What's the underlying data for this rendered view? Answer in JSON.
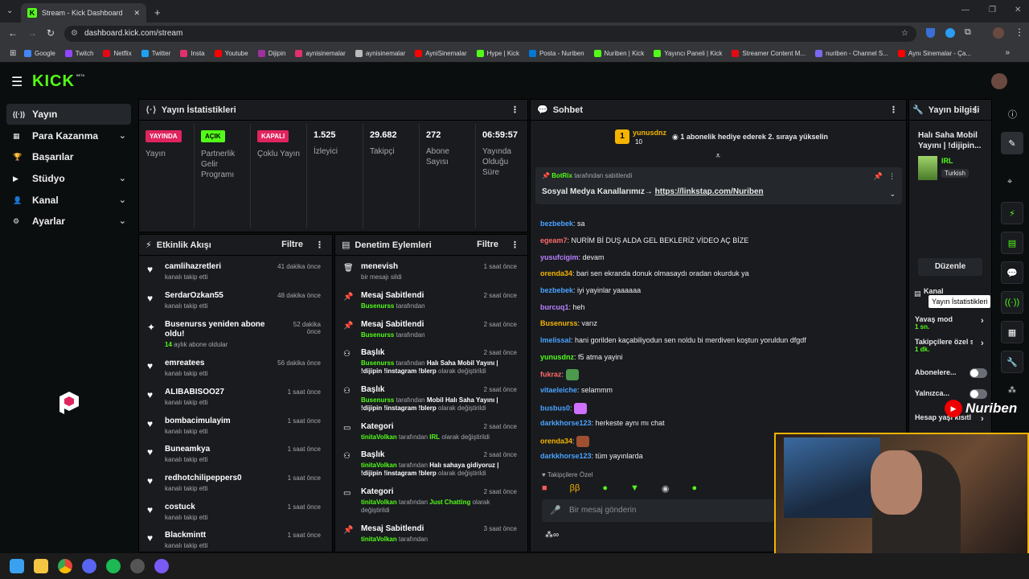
{
  "browser": {
    "tab_title": "Stream - Kick Dashboard",
    "url": "dashboard.kick.com/stream"
  },
  "bookmarks": [
    {
      "label": "Google",
      "color": "#4285f4"
    },
    {
      "label": "Twitch",
      "color": "#9146ff"
    },
    {
      "label": "Netflix",
      "color": "#e50914"
    },
    {
      "label": "Twitter",
      "color": "#1da1f2"
    },
    {
      "label": "Insta",
      "color": "#e1306c"
    },
    {
      "label": "Youtube",
      "color": "#ff0000"
    },
    {
      "label": "Dijipin",
      "color": "#a030a0"
    },
    {
      "label": "aynisinemalar",
      "color": "#e1306c"
    },
    {
      "label": "aynisinemalar",
      "color": "#bbbbbb"
    },
    {
      "label": "AyniSinemalar",
      "color": "#ff0000"
    },
    {
      "label": "Hype | Kick",
      "color": "#53fc18"
    },
    {
      "label": "Posta - Nuriben",
      "color": "#0078d4"
    },
    {
      "label": "Nuriben | Kick",
      "color": "#53fc18"
    },
    {
      "label": "Yayıncı Paneli | Kick",
      "color": "#53fc18"
    },
    {
      "label": "Streamer Content M...",
      "color": "#e50914"
    },
    {
      "label": "nuriben - Channel S...",
      "color": "#7a6af0"
    },
    {
      "label": "Aynı Sinemalar - Ça...",
      "color": "#ff0000"
    }
  ],
  "brand": {
    "logo": "KICK",
    "beta": "BETA",
    "accent": "#53fc18"
  },
  "sidebar": [
    {
      "label": "Yayın",
      "icon": "broadcast-icon"
    },
    {
      "label": "Para Kazanma",
      "icon": "money-icon"
    },
    {
      "label": "Başarılar",
      "icon": "trophy-icon"
    },
    {
      "label": "Stüdyo",
      "icon": "video-icon"
    },
    {
      "label": "Kanal",
      "icon": "user-icon"
    },
    {
      "label": "Ayarlar",
      "icon": "gear-icon"
    }
  ],
  "stats": {
    "title": "Yayın İstatistikleri",
    "items": [
      {
        "badge": "YAYINDA",
        "label": "Yayın"
      },
      {
        "badge": "AÇIK",
        "label": "Partnerlik Gelir Programı"
      },
      {
        "badge": "KAPALI",
        "label": "Çoklu Yayın"
      },
      {
        "value": "1.525",
        "label": "İzleyici"
      },
      {
        "value": "29.682",
        "label": "Takipçi"
      },
      {
        "value": "272",
        "label": "Abone Sayısı"
      },
      {
        "value": "06:59:57",
        "label": "Yayında Olduğu Süre"
      }
    ]
  },
  "activity": {
    "title": "Etkinlik Akışı",
    "filter": "Filtre",
    "items": [
      {
        "name": "camlihazretleri",
        "sub": "kanalı takip etti",
        "time": "41 dakika önce"
      },
      {
        "name": "SerdarOzkan55",
        "sub": "kanalı takip etti",
        "time": "48 dakika önce"
      },
      {
        "name": "Busenurss yeniden abone oldu!",
        "sub_num": "14",
        "sub": "aylık abone oldular",
        "time": "52 dakika önce"
      },
      {
        "name": "emreatees",
        "sub": "kanalı takip etti",
        "time": "56 dakika önce"
      },
      {
        "name": "ALIBABISOO27",
        "sub": "kanalı takip etti",
        "time": "1 saat önce"
      },
      {
        "name": "bombacimulayim",
        "sub": "kanalı takip etti",
        "time": "1 saat önce"
      },
      {
        "name": "Buneamkya",
        "sub": "kanalı takip etti",
        "time": "1 saat önce"
      },
      {
        "name": "redhotchilipeppers0",
        "sub": "kanalı takip etti",
        "time": "1 saat önce"
      },
      {
        "name": "costuck",
        "sub": "kanalı takip etti",
        "time": "1 saat önce"
      },
      {
        "name": "Blackmintt",
        "sub": "kanalı takip etti",
        "time": "1 saat önce"
      }
    ]
  },
  "moderation": {
    "title": "Denetim Eylemleri",
    "filter": "Filtre",
    "items": [
      {
        "name": "menevish",
        "sub": "bir mesajı sildi",
        "time": "1 saat önce",
        "icon": "trash-icon"
      },
      {
        "name": "Mesaj Sabitlendi",
        "actor": "Busenurss",
        "sub": "tarafından",
        "time": "2 saat önce",
        "icon": "pin-icon"
      },
      {
        "name": "Mesaj Sabitlendi",
        "actor": "Busenurss",
        "sub": "tarafından",
        "time": "2 saat önce",
        "icon": "pin-icon"
      },
      {
        "name": "Başlık",
        "actor": "Busenurss",
        "sub": "tarafından",
        "detail": "Halı Saha Mobil Yayını | !dijipin !instagram !blerp",
        "suffix": "olarak değiştirildi",
        "time": "2 saat önce",
        "icon": "title-icon"
      },
      {
        "name": "Başlık",
        "actor": "Busenurss",
        "sub": "tarafından",
        "detail": "Mobil Halı Saha Yayını | !dijipin !instagram !blerp",
        "suffix": "olarak değiştirildi",
        "time": "2 saat önce",
        "icon": "title-icon"
      },
      {
        "name": "Kategori",
        "actor": "tinitaVolkan",
        "sub": "tarafından",
        "detail": "IRL",
        "suffix": "olarak değiştirildi",
        "time": "2 saat önce",
        "icon": "category-icon"
      },
      {
        "name": "Başlık",
        "actor": "tinitaVolkan",
        "sub": "tarafından",
        "detail": "Halı sahaya gidiyoruz | !dijipin !instagram !blerp",
        "suffix": "olarak değiştirildi",
        "time": "2 saat önce",
        "icon": "title-icon"
      },
      {
        "name": "Kategori",
        "actor": "tinitaVolkan",
        "sub": "tarafından",
        "detail": "Just Chatting",
        "suffix": "olarak değiştirildi",
        "time": "2 saat önce",
        "icon": "category-icon"
      },
      {
        "name": "Mesaj Sabitlendi",
        "actor": "tinitaVolkan",
        "sub": "tarafından",
        "time": "3 saat önce",
        "icon": "pin-icon"
      }
    ]
  },
  "chat": {
    "title": "Sohbet",
    "gift": {
      "user": "yunusdnz",
      "count": "10",
      "text": "1 abonelik hediye ederek 2. sıraya yükselin"
    },
    "pinned": {
      "by": "BotRix",
      "by_suffix": "tarafından sabitlendi",
      "text": "Sosyal Medya Kanallarımız→",
      "link": "https://linkstap.com/Nuriben"
    },
    "messages": [
      {
        "user": "bezbebek",
        "color": "#4aa3ff",
        "text": "sa"
      },
      {
        "user": "egeam7",
        "color": "#ff6b6b",
        "text": "NURİM Bİ DUŞ ALDA GEL BEKLERİZ VİDEO AÇ BİZE"
      },
      {
        "user": "yusufcigim",
        "color": "#b980ff",
        "text": "devam"
      },
      {
        "user": "orenda34",
        "color": "#f5b400",
        "text": "bari sen ekranda donuk olmasaydı oradan okurduk ya"
      },
      {
        "user": "bezbebek",
        "color": "#4aa3ff",
        "text": "iyi yayinlar yaaaaaa"
      },
      {
        "user": "burcuq1",
        "color": "#b980ff",
        "text": "heh"
      },
      {
        "user": "Busenurss",
        "color": "#f5b400",
        "text": "varız"
      },
      {
        "user": "lmelissal",
        "color": "#4aa3ff",
        "text": "hani gorilden kaçabiliyodun sen noldu bi merdiven koştun yoruldun dfgdf"
      },
      {
        "user": "yunusdnz",
        "color": "#53fc18",
        "text": "f5 atma yayini"
      },
      {
        "user": "fukraz",
        "color": "#ff6b6b",
        "text": ""
      },
      {
        "user": "vitaeleiche",
        "color": "#4aa3ff",
        "text": "selammm"
      },
      {
        "user": "busbus0",
        "color": "#4aa3ff",
        "text": ""
      },
      {
        "user": "darkkhorse123",
        "color": "#4aa3ff",
        "text": "herkeste aynı mı chat"
      },
      {
        "user": "orenda34",
        "color": "#f5b400",
        "text": ""
      },
      {
        "user": "darkkhorse123",
        "color": "#4aa3ff",
        "text": "tüm yayınlarda"
      }
    ],
    "followers_only": "Takipçilere Özel",
    "input_placeholder": "Bir mesaj gönderin"
  },
  "info": {
    "title": "Yayın bilgisi",
    "stream_title": "Halı Saha Mobil Yayını | !dijipin...",
    "category": "IRL",
    "language": "Turkish",
    "edit": "Düzenle",
    "channel_label": "Kanal",
    "tooltip": "Yayın İstatistikleri",
    "settings": [
      {
        "label": "Yavaş mod",
        "value": "1 sn."
      },
      {
        "label": "Takipçilere özel s",
        "value": "1 dk."
      },
      {
        "label": "Abonelere...",
        "toggle": true
      },
      {
        "label": "Yalnızca...",
        "toggle": true
      },
      {
        "label": "Hesap yaşı kısıtl"
      }
    ]
  },
  "overlay": {
    "channel_name": "Nuriben",
    "watermark": "logi"
  }
}
